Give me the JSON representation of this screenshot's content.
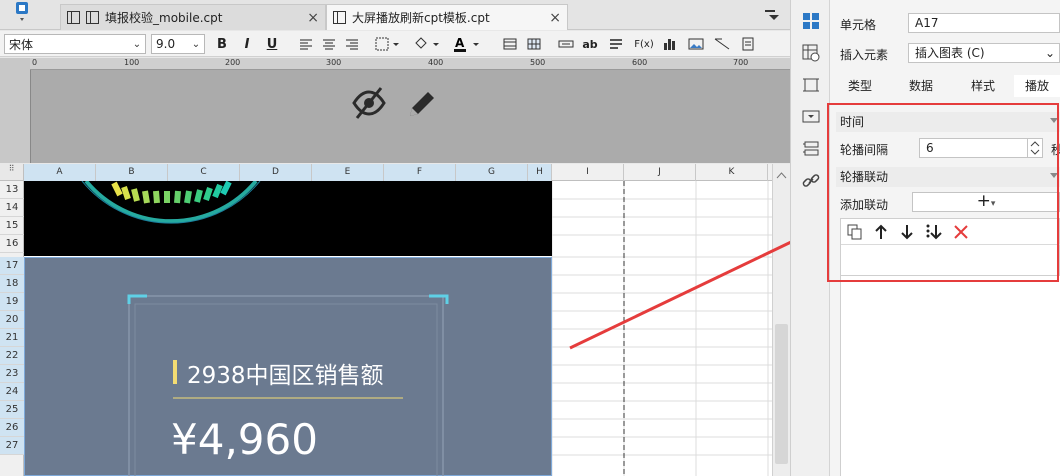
{
  "tabs": [
    {
      "label": "填报校验_mobile.cpt",
      "active": false
    },
    {
      "label": "大屏播放刷新cpt模板.cpt",
      "active": true
    }
  ],
  "toolbar": {
    "font_name": "宋体",
    "font_size": "9.0",
    "bold": "B",
    "italic": "I",
    "underline": "U",
    "text_abc": "abc",
    "text_ab": "ab",
    "text_fx": "F(x)"
  },
  "ruler_ticks": [
    "0",
    "100",
    "200",
    "300",
    "400",
    "500",
    "600",
    "700"
  ],
  "columns": [
    "A",
    "B",
    "C",
    "D",
    "E",
    "F",
    "G",
    "H",
    "I",
    "J",
    "K"
  ],
  "rows": [
    "13",
    "14",
    "15",
    "16",
    "17",
    "18",
    "19",
    "20",
    "21",
    "22",
    "23",
    "24",
    "25",
    "26",
    "27"
  ],
  "card": {
    "title": "2938中国区销售额",
    "value": "¥4,960"
  },
  "panel": {
    "cell_label": "单元格",
    "cell_value": "A17",
    "insert_label": "插入元素",
    "insert_value": "插入图表 (C)",
    "tabs": [
      "类型",
      "数据",
      "样式",
      "播放"
    ],
    "section_time": "时间",
    "interval_label": "轮播间隔",
    "interval_value": "6",
    "interval_unit": "秒",
    "section_link": "轮播联动",
    "add_link_label": "添加联动",
    "add_link_button": "+"
  },
  "colors": {
    "highlight_box": "#e53c3c",
    "slate_bg": "#6b7a90",
    "card_corner": "#5fd0e6",
    "title_bar": "#f3dc73",
    "select_header": "#cfe3f2"
  }
}
